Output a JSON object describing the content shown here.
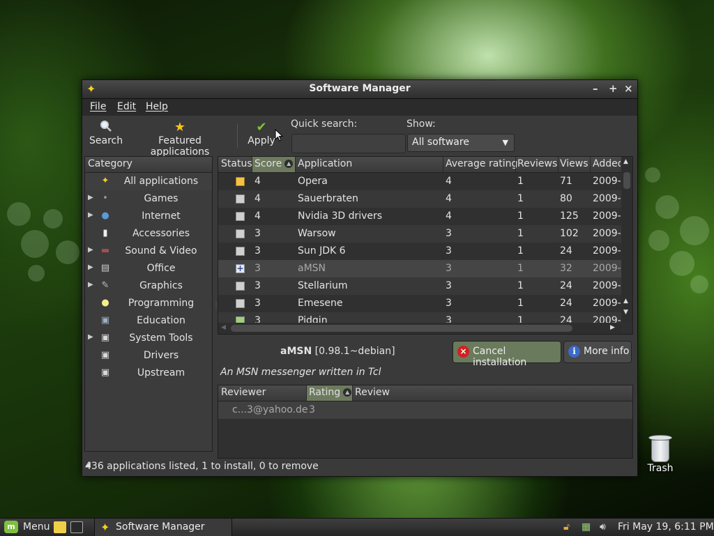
{
  "window": {
    "title": "Software Manager",
    "controls": {
      "minimize": "–",
      "maximize": "+",
      "close": "×"
    }
  },
  "menubar": {
    "file": "File",
    "edit": "Edit",
    "help": "Help"
  },
  "toolbar": {
    "search": "Search",
    "featured": "Featured applications",
    "apply": "Apply",
    "quick_search_label": "Quick search:",
    "quick_search_value": "",
    "show_label": "Show:",
    "show_value": "All software"
  },
  "categories": {
    "header": "Category",
    "items": [
      {
        "label": "All applications",
        "icon": "sparkle-icon"
      },
      {
        "label": "Games",
        "icon": "joystick-icon"
      },
      {
        "label": "Internet",
        "icon": "globe-icon"
      },
      {
        "label": "Accessories",
        "icon": "notepad-icon"
      },
      {
        "label": "Sound & Video",
        "icon": "film-icon"
      },
      {
        "label": "Office",
        "icon": "document-icon"
      },
      {
        "label": "Graphics",
        "icon": "brush-icon"
      },
      {
        "label": "Programming",
        "icon": "lightbulb-icon"
      },
      {
        "label": "Education",
        "icon": "education-icon"
      },
      {
        "label": "System Tools",
        "icon": "tools-icon"
      },
      {
        "label": "Drivers",
        "icon": "drivers-icon"
      },
      {
        "label": "Upstream",
        "icon": "upstream-icon"
      }
    ]
  },
  "app_list": {
    "columns": {
      "status": "Status",
      "score": "Score",
      "application": "Application",
      "average_rating": "Average rating",
      "reviews": "Reviews",
      "views": "Views",
      "added": "Added"
    },
    "rows": [
      {
        "score": "4",
        "name": "Opera",
        "rating": "4",
        "reviews": "1",
        "views": "71",
        "added": "2009-"
      },
      {
        "score": "4",
        "name": "Sauerbraten",
        "rating": "4",
        "reviews": "1",
        "views": "80",
        "added": "2009-"
      },
      {
        "score": "4",
        "name": "Nvidia 3D drivers",
        "rating": "4",
        "reviews": "1",
        "views": "125",
        "added": "2009-"
      },
      {
        "score": "3",
        "name": "Warsow",
        "rating": "3",
        "reviews": "1",
        "views": "102",
        "added": "2009-"
      },
      {
        "score": "3",
        "name": "Sun JDK 6",
        "rating": "3",
        "reviews": "1",
        "views": "24",
        "added": "2009-"
      },
      {
        "score": "3",
        "name": "aMSN",
        "rating": "3",
        "reviews": "1",
        "views": "32",
        "added": "2009-"
      },
      {
        "score": "3",
        "name": "Stellarium",
        "rating": "3",
        "reviews": "1",
        "views": "24",
        "added": "2009-"
      },
      {
        "score": "3",
        "name": "Emesene",
        "rating": "3",
        "reviews": "1",
        "views": "24",
        "added": "2009-"
      },
      {
        "score": "3",
        "name": "Pidgin",
        "rating": "3",
        "reviews": "1",
        "views": "24",
        "added": "2009-"
      }
    ]
  },
  "detail": {
    "app_name": "aMSN",
    "app_version": "[0.98.1~debian]",
    "cancel_button": "Cancel installation",
    "more_button": "More info",
    "description": "An MSN messenger written in Tcl",
    "reviews": {
      "columns": {
        "reviewer": "Reviewer",
        "rating": "Rating",
        "review": "Review"
      },
      "rows": [
        {
          "reviewer": "c...3@yahoo.de",
          "rating": "3",
          "review": ""
        }
      ]
    }
  },
  "statusbar": {
    "text": "436 applications listed, 1 to install, 0 to remove"
  },
  "desktop": {
    "trash": "Trash"
  },
  "panel": {
    "menu": "Menu",
    "task": "Software Manager",
    "clock": "Fri May 19,  6:11 PM"
  },
  "colors": {
    "accent": "#6d7a5e",
    "mint": "#7fbf3f",
    "cancel_icon": "#d42020",
    "info_icon": "#3c6ac8"
  }
}
